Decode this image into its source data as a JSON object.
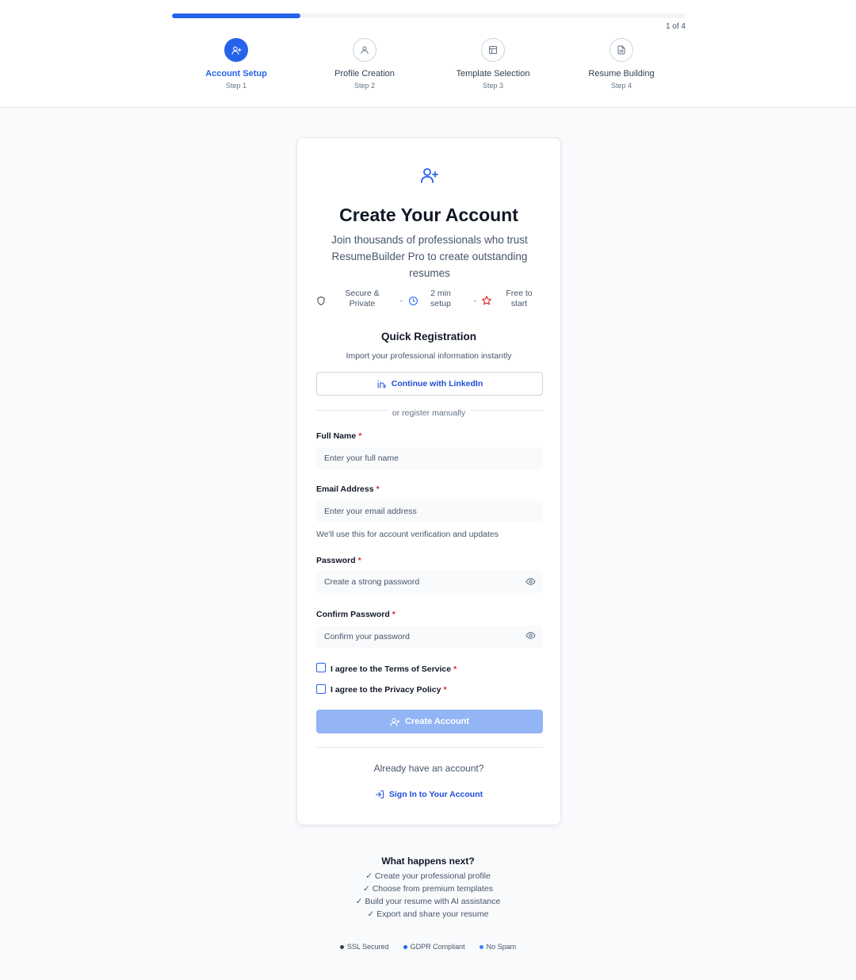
{
  "progress": {
    "text": "1 of 4",
    "fraction": 0.25
  },
  "steps": [
    {
      "label": "Account Setup",
      "sub": "Step 1",
      "active": true
    },
    {
      "label": "Profile Creation",
      "sub": "Step 2",
      "active": false
    },
    {
      "label": "Template Selection",
      "sub": "Step 3",
      "active": false
    },
    {
      "label": "Resume Building",
      "sub": "Step 4",
      "active": false
    }
  ],
  "card": {
    "title": "Create Your Account",
    "subtitle": "Join thousands of professionals who trust ResumeBuilder Pro to create outstanding resumes",
    "features": [
      {
        "icon": "shield-icon",
        "text": "Secure & Private"
      },
      {
        "icon": "clock-icon",
        "text": "2 min setup"
      },
      {
        "icon": "star-icon",
        "text": "Free to start"
      }
    ],
    "quick_title": "Quick Registration",
    "quick_sub": "Import your professional information instantly",
    "linkedin_label": "Continue with LinkedIn",
    "divider_text": "or register manually",
    "full_name": {
      "label": "Full Name",
      "placeholder": "Enter your full name",
      "value": ""
    },
    "email": {
      "label": "Email Address",
      "placeholder": "Enter your email address",
      "value": "",
      "help": "We'll use this for account verification and updates"
    },
    "password": {
      "label": "Password",
      "placeholder": "Create a strong password",
      "value": ""
    },
    "confirm_password": {
      "label": "Confirm Password",
      "placeholder": "Confirm your password",
      "value": ""
    },
    "required_mark": "*",
    "terms_label": "I agree to the Terms of Service",
    "privacy_label": "I agree to the Privacy Policy",
    "create_label": "Create Account",
    "have_account": "Already have an account?",
    "signin_label": "Sign In to Your Account"
  },
  "next": {
    "title": "What happens next?",
    "items": [
      "✓ Create your professional profile",
      "✓ Choose from premium templates",
      "✓ Build your resume with AI assistance",
      "✓ Export and share your resume"
    ]
  },
  "badges": [
    {
      "label": "SSL Secured",
      "color": "#334155"
    },
    {
      "label": "GDPR Compliant",
      "color": "#2563eb"
    },
    {
      "label": "No Spam",
      "color": "#3b82f6"
    }
  ],
  "colors": {
    "accent": "#2563eb",
    "required": "#dc2626",
    "star": "#dc2626"
  }
}
